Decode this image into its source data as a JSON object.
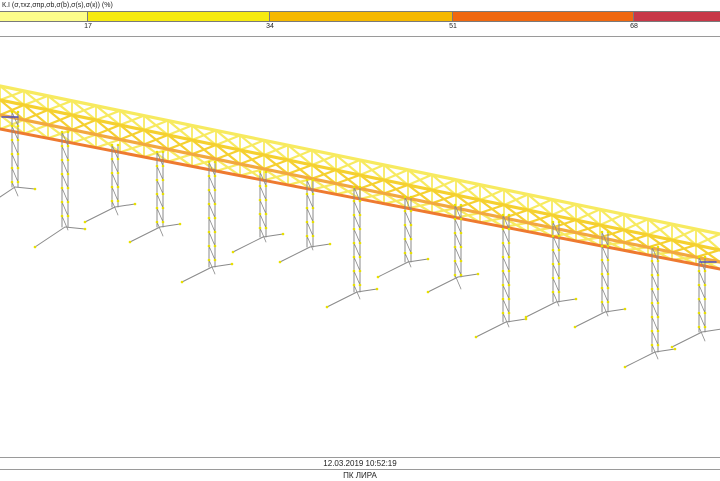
{
  "legend": {
    "title": "К.I (σ,τxz,σпр,σb,σ(b),σ(s),σ(к)) (%)",
    "segments": [
      {
        "color": "#fdfd8a"
      },
      {
        "color": "#f6ea10"
      },
      {
        "color": "#f5b800"
      },
      {
        "color": "#f06810"
      },
      {
        "color": "#c83848"
      }
    ],
    "ticks": [
      "17",
      "34",
      "51",
      "68"
    ]
  },
  "footer": {
    "timestamp": "12.03.2019 10:52:19",
    "project": "ПК ЛИРА"
  },
  "colors": {
    "truss_light": "#f7ea60",
    "truss_mid": "#f5d030",
    "truss_strong": "#f2a840",
    "truss_hot": "#ee7a30",
    "support": "#8a8a8a",
    "node": "#e8e000",
    "marker": "#5050c0"
  }
}
